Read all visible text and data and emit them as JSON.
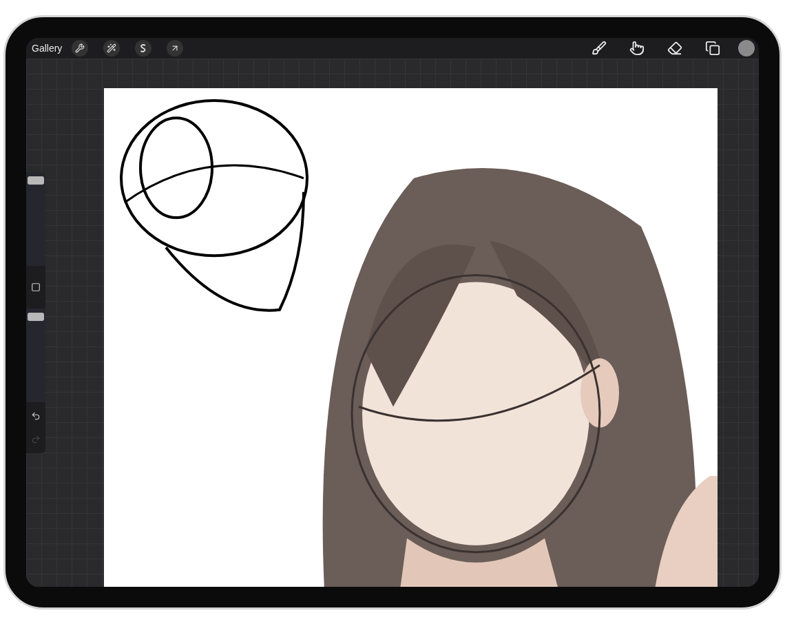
{
  "toolbar": {
    "gallery": "Gallery",
    "left_tools": [
      {
        "kind": "wrench"
      },
      {
        "kind": "wand"
      },
      {
        "kind": "selection"
      },
      {
        "kind": "transform"
      }
    ],
    "right_tools": [
      {
        "kind": "brush"
      },
      {
        "kind": "smudge"
      },
      {
        "kind": "eraser"
      },
      {
        "kind": "layers"
      }
    ]
  },
  "sidebar": {
    "size_slider": {
      "level": 0.95
    },
    "opacity_slider": {
      "level": 0.95
    },
    "buttons": [
      {
        "kind": "undo",
        "disabled": false
      },
      {
        "kind": "redo",
        "disabled": true
      }
    ]
  }
}
